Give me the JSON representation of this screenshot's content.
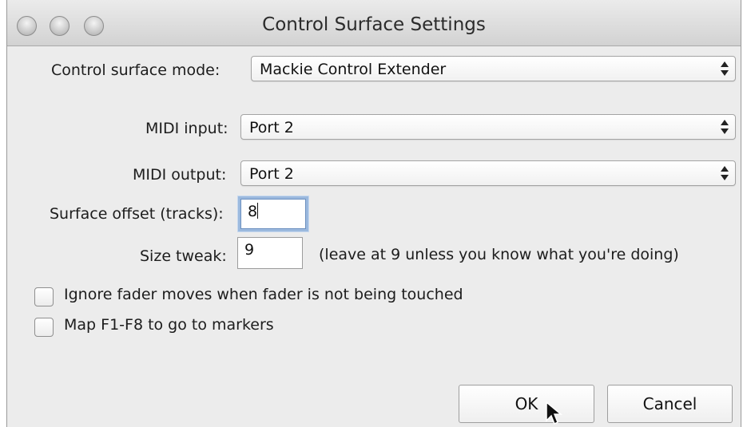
{
  "window": {
    "title": "Control Surface Settings"
  },
  "form": {
    "mode_label": "Control surface mode:",
    "mode_value": "Mackie Control Extender",
    "midi_input_label": "MIDI input:",
    "midi_input_value": "Port 2",
    "midi_output_label": "MIDI output:",
    "midi_output_value": "Port 2",
    "offset_label": "Surface offset (tracks):",
    "offset_value": "8",
    "size_label": "Size tweak:",
    "size_value": "9",
    "size_hint": "(leave at 9 unless you know what you're doing)"
  },
  "options": [
    {
      "label": "Ignore fader moves when fader is not being touched",
      "checked": false
    },
    {
      "label": "Map F1-F8 to go to markers",
      "checked": false
    }
  ],
  "buttons": {
    "ok": "OK",
    "cancel": "Cancel"
  }
}
